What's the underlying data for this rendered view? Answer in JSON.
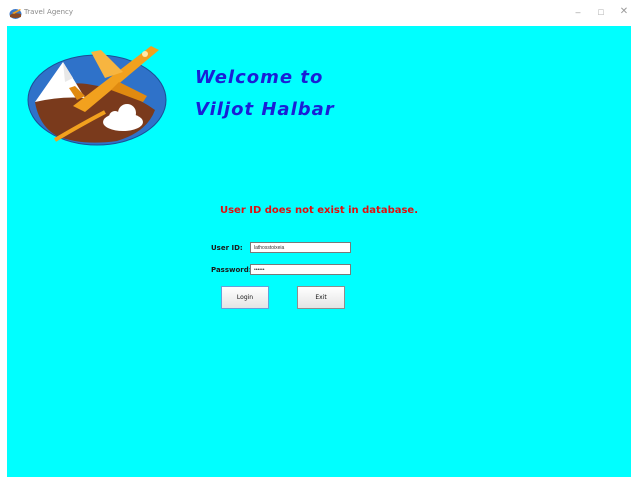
{
  "window": {
    "title": "Travel Agency",
    "controls": {
      "minimize": "–",
      "maximize": "□",
      "close": "✕"
    }
  },
  "header": {
    "welcome_line1": "Welcome to",
    "welcome_line2": "Viljot Halbar"
  },
  "status": {
    "error_message": "User ID does not exist in database.",
    "error_color": "#e01010"
  },
  "form": {
    "user_id_label": "User ID:",
    "user_id_value": "lathosstoixeia",
    "password_label": "Password:",
    "password_value": "••••••"
  },
  "buttons": {
    "login_label": "Login",
    "exit_label": "Exit"
  },
  "theme": {
    "background": "#00ffff",
    "welcome_color": "#1a1fd6"
  }
}
